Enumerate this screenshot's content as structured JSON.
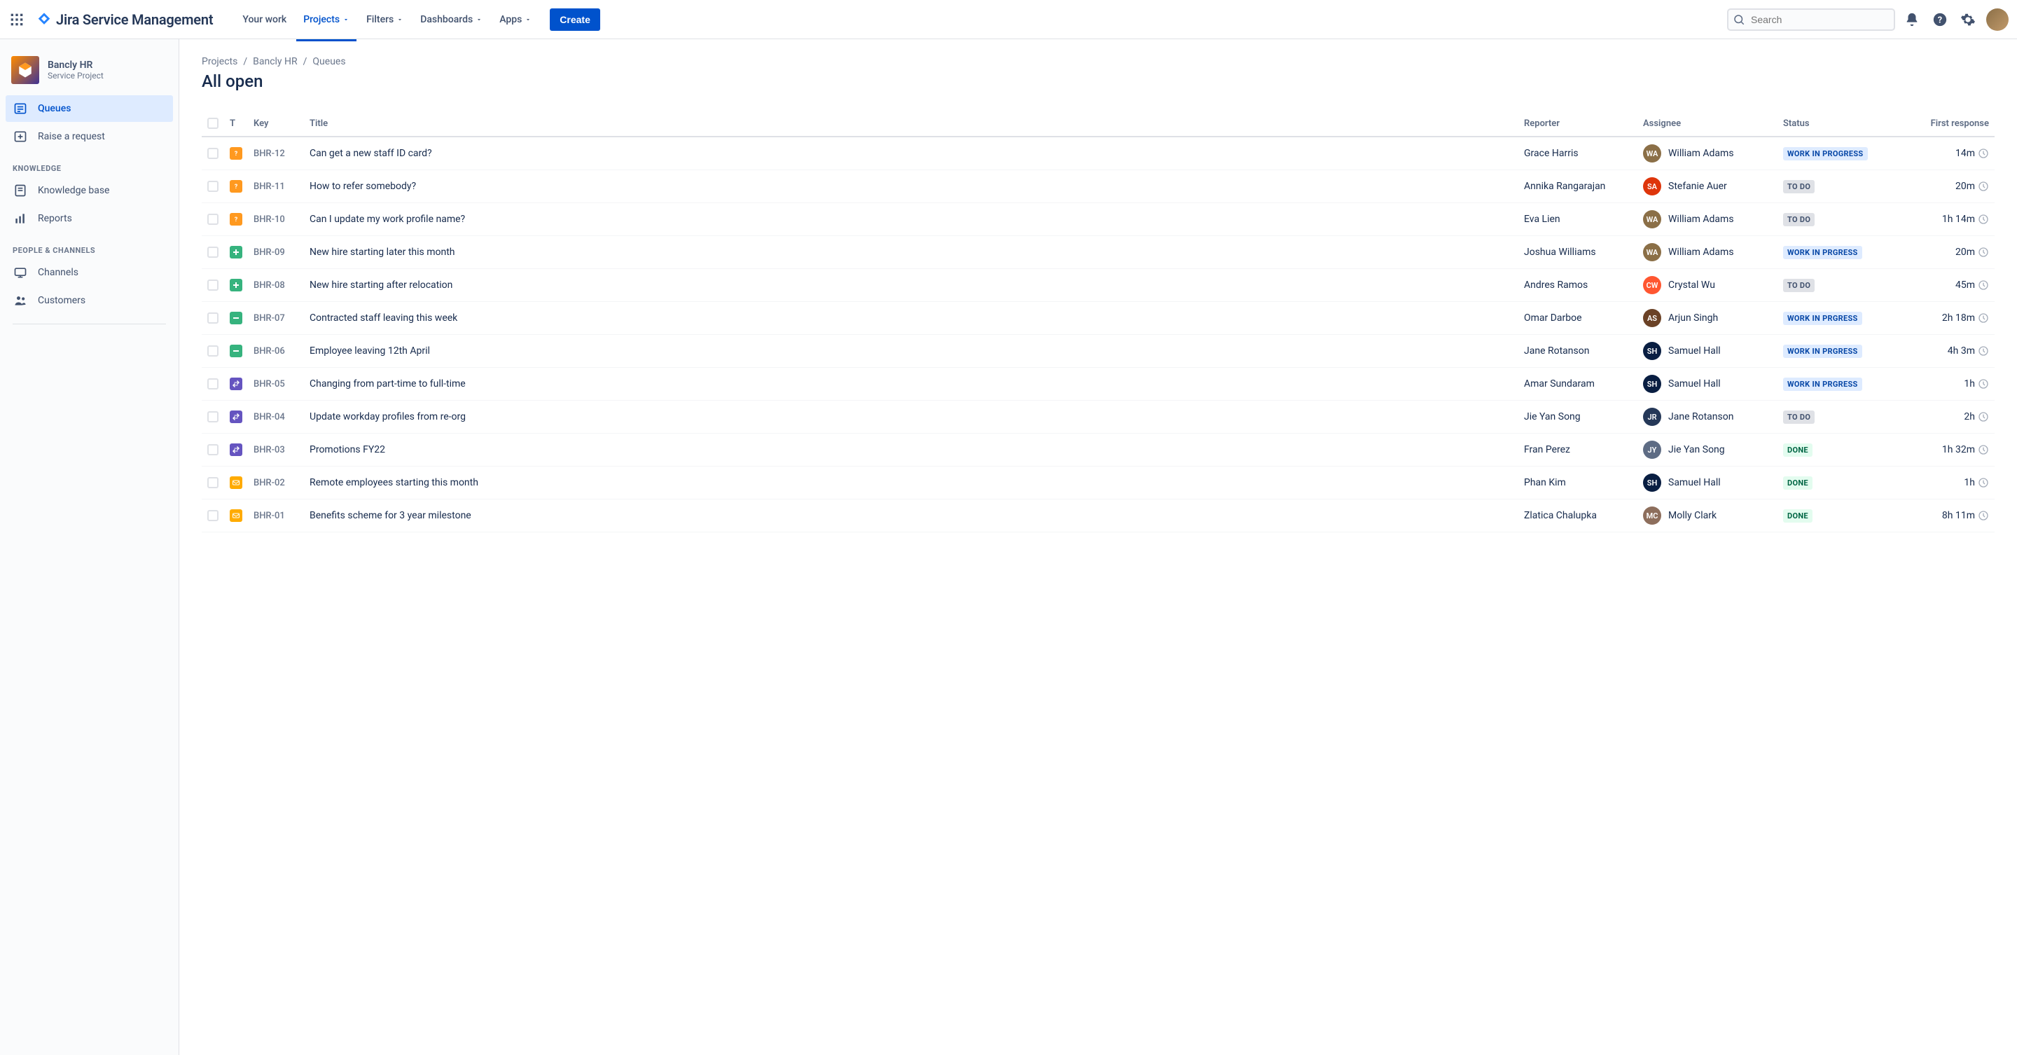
{
  "app_name": "Jira Service Management",
  "topnav": {
    "your_work": "Your work",
    "projects": "Projects",
    "filters": "Filters",
    "dashboards": "Dashboards",
    "apps": "Apps",
    "create": "Create"
  },
  "search": {
    "placeholder": "Search"
  },
  "sidebar": {
    "project_name": "Bancly HR",
    "project_type": "Service Project",
    "items": {
      "queues": "Queues",
      "raise_request": "Raise a request"
    },
    "section_knowledge": "KNOWLEDGE",
    "knowledge_items": {
      "knowledge_base": "Knowledge base",
      "reports": "Reports"
    },
    "section_people": "PEOPLE & CHANNELS",
    "people_items": {
      "channels": "Channels",
      "customers": "Customers"
    }
  },
  "breadcrumbs": {
    "projects": "Projects",
    "project": "Bancly HR",
    "queues": "Queues"
  },
  "page_title": "All open",
  "columns": {
    "type": "T",
    "key": "Key",
    "title": "Title",
    "reporter": "Reporter",
    "assignee": "Assignee",
    "status": "Status",
    "first_response": "First response"
  },
  "status_labels": {
    "wip": "WORK IN PROGRESS",
    "wip2": "WORK IN PRGRESS",
    "todo": "TO DO",
    "done": "DONE"
  },
  "rows": [
    {
      "type": "question",
      "key": "BHR-12",
      "title": "Can get a new staff ID card?",
      "reporter": "Grace Harris",
      "assignee": "William Adams",
      "status": "wip",
      "first_response": "14m",
      "av": "#8B6F47"
    },
    {
      "type": "question",
      "key": "BHR-11",
      "title": "How to refer somebody?",
      "reporter": "Annika Rangarajan",
      "assignee": "Stefanie Auer",
      "status": "todo",
      "first_response": "20m",
      "av": "#DE350B"
    },
    {
      "type": "question",
      "key": "BHR-10",
      "title": "Can I update my work profile name?",
      "reporter": "Eva Lien",
      "assignee": "William Adams",
      "status": "todo",
      "first_response": "1h 14m",
      "av": "#8B6F47"
    },
    {
      "type": "plus",
      "key": "BHR-09",
      "title": "New hire starting later this month",
      "reporter": "Joshua Williams",
      "assignee": "William Adams",
      "status": "wip2",
      "first_response": "20m",
      "av": "#8B6F47"
    },
    {
      "type": "plus",
      "key": "BHR-08",
      "title": "New hire starting after relocation",
      "reporter": "Andres Ramos",
      "assignee": "Crystal Wu",
      "status": "todo",
      "first_response": "45m",
      "av": "#FF5630"
    },
    {
      "type": "minus",
      "key": "BHR-07",
      "title": "Contracted staff leaving this week",
      "reporter": "Omar Darboe",
      "assignee": "Arjun Singh",
      "status": "wip2",
      "first_response": "2h 18m",
      "av": "#6B4226"
    },
    {
      "type": "minus",
      "key": "BHR-06",
      "title": "Employee leaving 12th April",
      "reporter": "Jane Rotanson",
      "assignee": "Samuel Hall",
      "status": "wip2",
      "first_response": "4h 3m",
      "av": "#091E42"
    },
    {
      "type": "change",
      "key": "BHR-05",
      "title": "Changing from part-time to full-time",
      "reporter": "Amar Sundaram",
      "assignee": "Samuel Hall",
      "status": "wip2",
      "first_response": "1h",
      "av": "#091E42"
    },
    {
      "type": "change",
      "key": "BHR-04",
      "title": "Update workday profiles from re-org",
      "reporter": "Jie Yan Song",
      "assignee": "Jane Rotanson",
      "status": "todo",
      "first_response": "2h",
      "av": "#253858"
    },
    {
      "type": "change",
      "key": "BHR-03",
      "title": "Promotions FY22",
      "reporter": "Fran Perez",
      "assignee": "Jie Yan Song",
      "status": "done",
      "first_response": "1h 32m",
      "av": "#5E6C84"
    },
    {
      "type": "mail",
      "key": "BHR-02",
      "title": "Remote employees starting this month",
      "reporter": "Phan Kim",
      "assignee": "Samuel Hall",
      "status": "done",
      "first_response": "1h",
      "av": "#091E42"
    },
    {
      "type": "mail",
      "key": "BHR-01",
      "title": "Benefits scheme for 3 year milestone",
      "reporter": "Zlatica Chalupka",
      "assignee": "Molly Clark",
      "status": "done",
      "first_response": "8h 11m",
      "av": "#8D6E5C"
    }
  ]
}
